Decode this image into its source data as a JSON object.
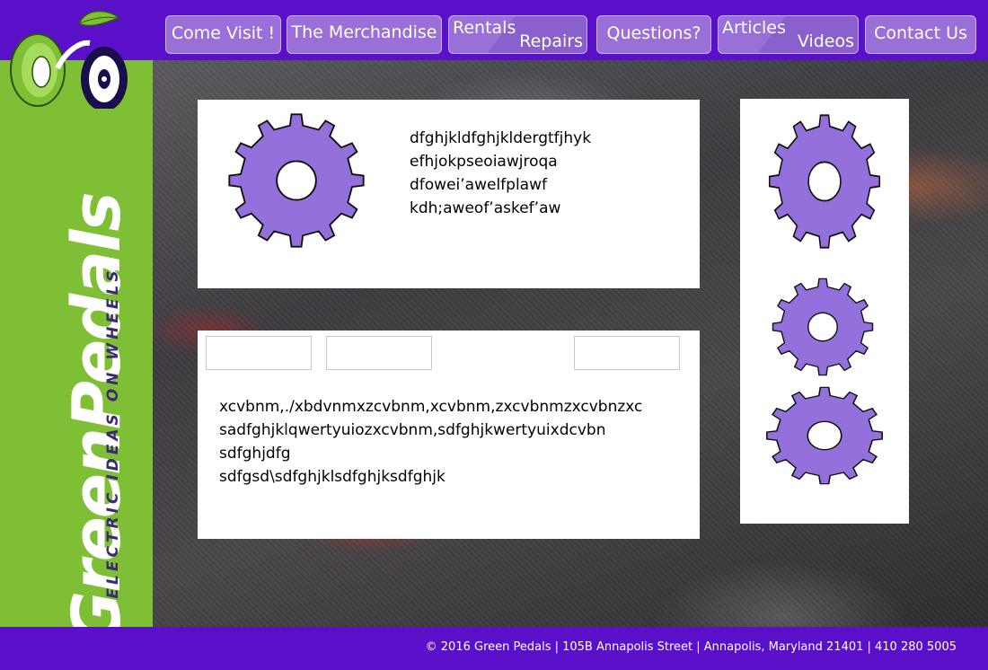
{
  "nav": {
    "come_visit": "Come Visit !",
    "merchandise": "The Merchandise",
    "rentals": "Rentals",
    "repairs": "Repairs",
    "questions": "Questions?",
    "articles": "Articles",
    "videos": "Videos",
    "contact": "Contact Us"
  },
  "brand": {
    "name": "GreenPedals",
    "tagline": "ELECTRIC IDEAS ON WHEELS"
  },
  "panel1": {
    "lines": [
      "dfghjkldfghjkldergtfjhyk",
      "efhjokpseoiawjroqa",
      "dfowei’awelfplawf",
      "kdh;aweof’askef’aw"
    ]
  },
  "panel2": {
    "lines": [
      "xcvbnm,./xbdvnmxzcvbnm,xcvbnm,zxcvbnmzxcvbnzxc",
      "sadfghjklqwertyuiozxcvbnm,sdfghjkwertyuixdcvbn",
      "sdfghjdfg",
      "sdfgsd\\sdfghjklsdfghjksdfghjk"
    ]
  },
  "footer": {
    "text": "© 2016 Green Pedals | 105B Annapolis Street | Annapolis, Maryland 21401 | 410 280 5005"
  },
  "colors": {
    "header_purple": "#5a0fc8",
    "button_purple": "#9a6fd8",
    "gear_purple": "#9370db",
    "sidebar_green": "#7fbf35"
  },
  "icons": [
    "gear-icon",
    "logo-wheel-icon",
    "leaf-icon"
  ]
}
